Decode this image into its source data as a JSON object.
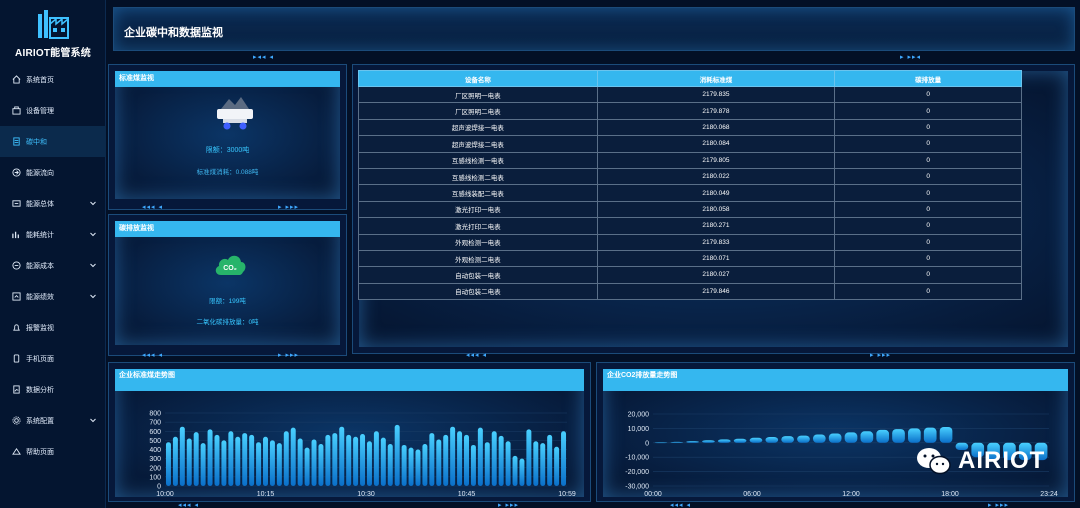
{
  "app": {
    "title": "AIRIOT能管系统"
  },
  "sidebar": {
    "items": [
      {
        "label": "系统首页",
        "icon": "home-icon",
        "expandable": false,
        "active": false
      },
      {
        "label": "设备管理",
        "icon": "device-icon",
        "expandable": false,
        "active": false
      },
      {
        "label": "碳中和",
        "icon": "document-icon",
        "expandable": false,
        "active": true
      },
      {
        "label": "能源流向",
        "icon": "flow-icon",
        "expandable": false,
        "active": false
      },
      {
        "label": "能源总体",
        "icon": "overview-icon",
        "expandable": true,
        "active": false
      },
      {
        "label": "能耗统计",
        "icon": "stats-icon",
        "expandable": true,
        "active": false
      },
      {
        "label": "能源成本",
        "icon": "cost-icon",
        "expandable": true,
        "active": false
      },
      {
        "label": "能源绩效",
        "icon": "performance-icon",
        "expandable": true,
        "active": false
      },
      {
        "label": "报警监视",
        "icon": "alarm-icon",
        "expandable": false,
        "active": false
      },
      {
        "label": "手机页面",
        "icon": "mobile-icon",
        "expandable": false,
        "active": false
      },
      {
        "label": "数据分析",
        "icon": "analysis-icon",
        "expandable": false,
        "active": false
      },
      {
        "label": "系统配置",
        "icon": "settings-icon",
        "expandable": true,
        "active": false
      },
      {
        "label": "帮助页面",
        "icon": "help-icon",
        "expandable": false,
        "active": false
      }
    ]
  },
  "header": {
    "title": "企业碳中和数据监视"
  },
  "coal_panel": {
    "title": "标准煤监视",
    "quota": "限额：3000吨",
    "consumption": "标准煤消耗：0.088吨"
  },
  "carbon_panel": {
    "title": "碳排放监视",
    "quota": "限额：199吨",
    "emission": "二氧化碳排放量：0吨"
  },
  "table": {
    "headers": [
      "设备名称",
      "消耗标准煤",
      "碳排放量"
    ],
    "rows": [
      [
        "厂区照明一电表",
        "2179.835",
        "0"
      ],
      [
        "厂区照明二电表",
        "2179.878",
        "0"
      ],
      [
        "超声波焊接一电表",
        "2180.068",
        "0"
      ],
      [
        "超声波焊接二电表",
        "2180.084",
        "0"
      ],
      [
        "互感线检测一电表",
        "2179.805",
        "0"
      ],
      [
        "互感线检测二电表",
        "2180.022",
        "0"
      ],
      [
        "互感线装配二电表",
        "2180.049",
        "0"
      ],
      [
        "激光打印一电表",
        "2180.058",
        "0"
      ],
      [
        "激光打印二电表",
        "2180.271",
        "0"
      ],
      [
        "外观检测一电表",
        "2179.833",
        "0"
      ],
      [
        "外观检测二电表",
        "2180.071",
        "0"
      ],
      [
        "自动包装一电表",
        "2180.027",
        "0"
      ],
      [
        "自动包装二电表",
        "2179.846",
        "0"
      ]
    ]
  },
  "chart_left": {
    "title": "企业标准煤走势图",
    "chart_data": {
      "type": "bar",
      "x_ticks": [
        "10:00",
        "10:15",
        "10:30",
        "10:45",
        "10:59"
      ],
      "y_ticks": [
        "800",
        "700",
        "600",
        "500",
        "400",
        "300",
        "200",
        "100",
        "0"
      ],
      "ylim": [
        0,
        800
      ],
      "values": [
        480,
        540,
        650,
        520,
        590,
        470,
        620,
        560,
        500,
        600,
        540,
        580,
        560,
        480,
        540,
        500,
        470,
        600,
        640,
        520,
        420,
        510,
        460,
        560,
        580,
        650,
        560,
        540,
        570,
        490,
        600,
        530,
        460,
        670,
        450,
        420,
        400,
        460,
        580,
        510,
        560,
        650,
        600,
        560,
        450,
        640,
        480,
        600,
        550,
        490,
        330,
        300,
        620,
        490,
        470,
        560,
        430,
        600
      ]
    },
    "brand_color": "#1fb6f5"
  },
  "chart_right": {
    "title": "企业CO2排放量走势图",
    "chart_data": {
      "type": "bar",
      "x_ticks": [
        "00:00",
        "06:00",
        "12:00",
        "18:00",
        "23:24"
      ],
      "y_ticks": [
        "20,000",
        "10,000",
        "0",
        "-10,000",
        "-20,000",
        "-30,000"
      ],
      "ylim": [
        -30000,
        20000
      ],
      "values": [
        300,
        600,
        1200,
        1800,
        2400,
        2800,
        3500,
        4000,
        4600,
        5000,
        5800,
        6500,
        7200,
        8000,
        9000,
        9500,
        10000,
        10500,
        11000,
        -5000,
        -10000,
        -12000,
        -12000,
        -12000,
        -12000
      ]
    }
  },
  "watermark": {
    "text": "AIRIOT"
  }
}
